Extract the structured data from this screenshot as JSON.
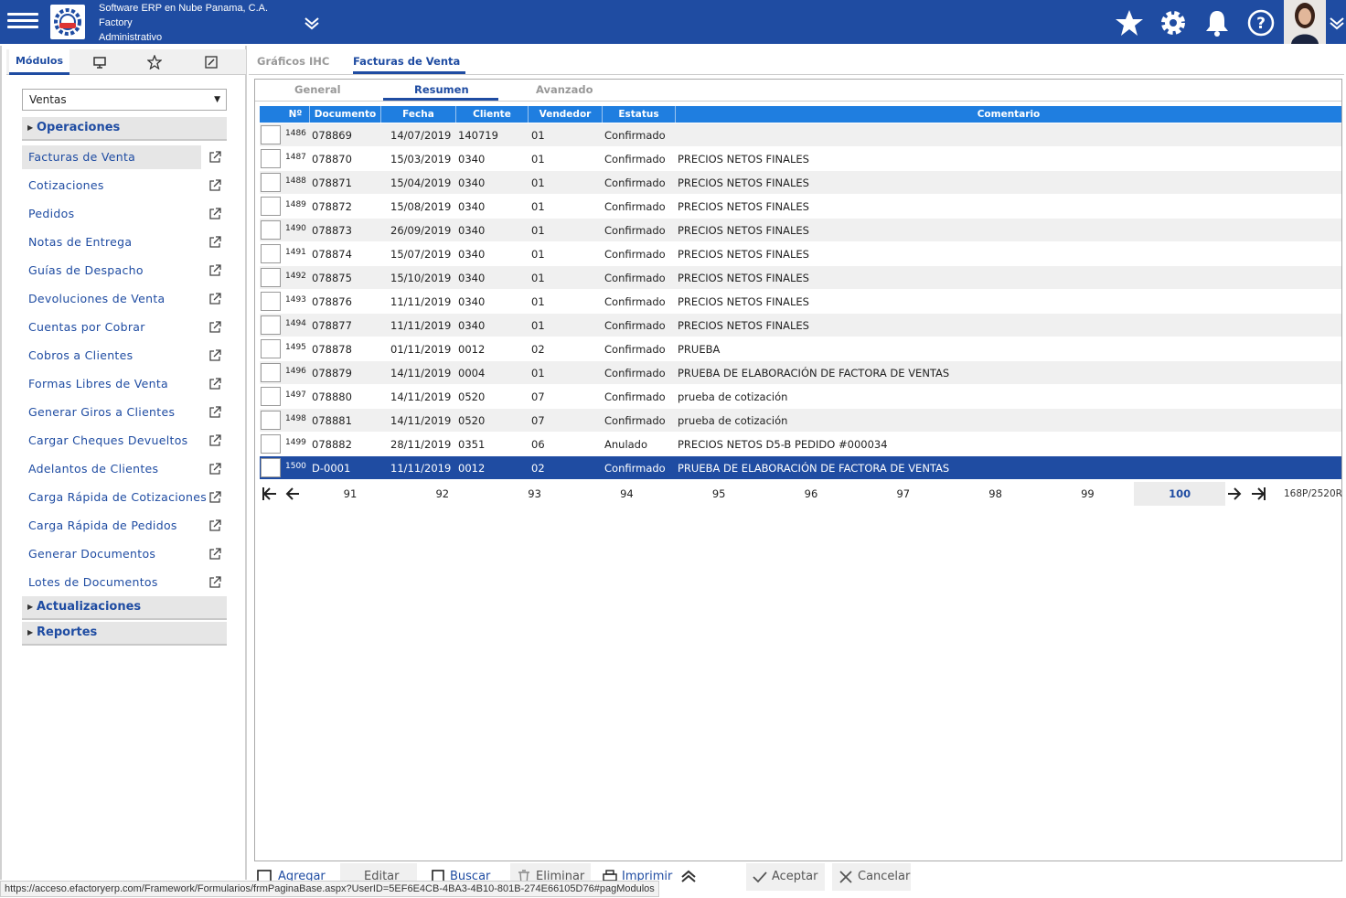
{
  "header": {
    "company_line1": "Software ERP en Nube Panama, C.A.",
    "company_line2": "Factory",
    "company_line3": "Administrativo"
  },
  "sidebar": {
    "tabs": [
      "Módulos"
    ],
    "module_select": "Ventas",
    "sections": {
      "operaciones": "Operaciones",
      "actualizaciones": "Actualizaciones",
      "reportes": "Reportes"
    },
    "items": [
      "Facturas de Venta",
      "Cotizaciones",
      "Pedidos",
      "Notas de Entrega",
      "Guías de Despacho",
      "Devoluciones de Venta",
      "Cuentas por Cobrar",
      "Cobros a Clientes",
      "Formas Libres de Venta",
      "Generar Giros a Clientes",
      "Cargar Cheques Devueltos",
      "Adelantos de Clientes",
      "Carga Rápida de Cotizaciones",
      "Carga Rápida de Pedidos",
      "Generar Documentos",
      "Lotes de Documentos"
    ]
  },
  "main": {
    "tabs": [
      "Gráficos IHC",
      "Facturas de Venta"
    ],
    "subtabs": [
      "General",
      "Resumen",
      "Avanzado"
    ],
    "columns": [
      "Nº",
      "Documento",
      "Fecha",
      "Cliente",
      "Vendedor",
      "Estatus",
      "Comentario"
    ],
    "rows": [
      {
        "n": "1486",
        "doc": "078869",
        "fecha": "14/07/2019",
        "cliente": "140719",
        "vend": "01",
        "estatus": "Confirmado",
        "coment": ""
      },
      {
        "n": "1487",
        "doc": "078870",
        "fecha": "15/03/2019",
        "cliente": "0340",
        "vend": "01",
        "estatus": "Confirmado",
        "coment": "PRECIOS NETOS FINALES"
      },
      {
        "n": "1488",
        "doc": "078871",
        "fecha": "15/04/2019",
        "cliente": "0340",
        "vend": "01",
        "estatus": "Confirmado",
        "coment": "PRECIOS NETOS FINALES"
      },
      {
        "n": "1489",
        "doc": "078872",
        "fecha": "15/08/2019",
        "cliente": "0340",
        "vend": "01",
        "estatus": "Confirmado",
        "coment": "PRECIOS NETOS FINALES"
      },
      {
        "n": "1490",
        "doc": "078873",
        "fecha": "26/09/2019",
        "cliente": "0340",
        "vend": "01",
        "estatus": "Confirmado",
        "coment": "PRECIOS NETOS FINALES"
      },
      {
        "n": "1491",
        "doc": "078874",
        "fecha": "15/07/2019",
        "cliente": "0340",
        "vend": "01",
        "estatus": "Confirmado",
        "coment": "PRECIOS NETOS FINALES"
      },
      {
        "n": "1492",
        "doc": "078875",
        "fecha": "15/10/2019",
        "cliente": "0340",
        "vend": "01",
        "estatus": "Confirmado",
        "coment": "PRECIOS NETOS FINALES"
      },
      {
        "n": "1493",
        "doc": "078876",
        "fecha": "11/11/2019",
        "cliente": "0340",
        "vend": "01",
        "estatus": "Confirmado",
        "coment": "PRECIOS NETOS FINALES"
      },
      {
        "n": "1494",
        "doc": "078877",
        "fecha": "11/11/2019",
        "cliente": "0340",
        "vend": "01",
        "estatus": "Confirmado",
        "coment": "PRECIOS NETOS FINALES"
      },
      {
        "n": "1495",
        "doc": "078878",
        "fecha": "01/11/2019",
        "cliente": "0012",
        "vend": "02",
        "estatus": "Confirmado",
        "coment": "PRUEBA"
      },
      {
        "n": "1496",
        "doc": "078879",
        "fecha": "14/11/2019",
        "cliente": "0004",
        "vend": "01",
        "estatus": "Confirmado",
        "coment": "PRUEBA DE ELABORACIÓN DE FACTORA DE VENTAS"
      },
      {
        "n": "1497",
        "doc": "078880",
        "fecha": "14/11/2019",
        "cliente": "0520",
        "vend": "07",
        "estatus": "Confirmado",
        "coment": "prueba de cotización"
      },
      {
        "n": "1498",
        "doc": "078881",
        "fecha": "14/11/2019",
        "cliente": "0520",
        "vend": "07",
        "estatus": "Confirmado",
        "coment": "prueba de cotización"
      },
      {
        "n": "1499",
        "doc": "078882",
        "fecha": "28/11/2019",
        "cliente": "0351",
        "vend": "06",
        "estatus": "Anulado",
        "coment": "PRECIOS NETOS D5-B PEDIDO #000034"
      },
      {
        "n": "1500",
        "doc": "D-0001",
        "fecha": "11/11/2019",
        "cliente": "0012",
        "vend": "02",
        "estatus": "Confirmado",
        "coment": "PRUEBA DE ELABORACIÓN DE FACTORA DE VENTAS"
      }
    ],
    "selected_row": 14,
    "pager": {
      "pages": [
        "91",
        "92",
        "93",
        "94",
        "95",
        "96",
        "97",
        "98",
        "99",
        "100"
      ],
      "current": "100",
      "info": "168P/2520R"
    }
  },
  "toolbar": {
    "agregar": "Agregar",
    "editar": "Editar",
    "buscar": "Buscar",
    "eliminar": "Eliminar",
    "imprimir": "Imprimir",
    "aceptar": "Aceptar",
    "cancelar": "Cancelar"
  },
  "statusbar": {
    "url": "https://acceso.efactoryerp.com/Framework/Formularios/frmPaginaBase.aspx?UserID=5EF6E4CB-4BA3-4B10-801B-274E66105D76#pagModulos"
  },
  "colors": {
    "brand": "#1f4ca2",
    "grid_header": "#1f7ee0",
    "selected_row": "#1f4ca2"
  }
}
